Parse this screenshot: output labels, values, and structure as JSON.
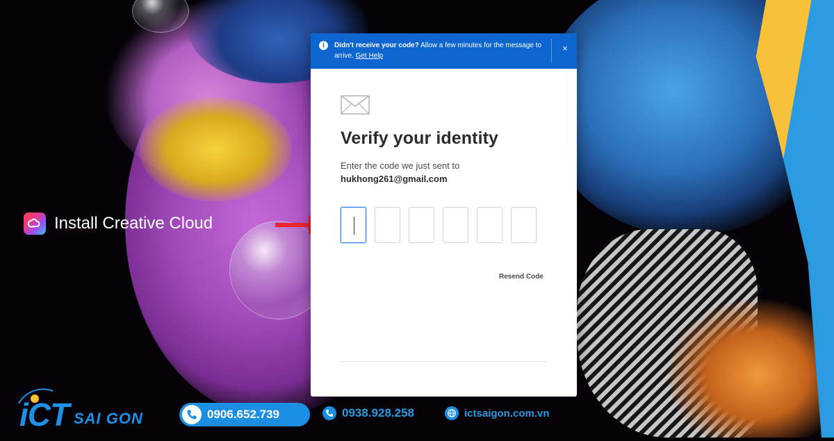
{
  "brand": {
    "install_label": "Install Creative Cloud",
    "ict_brand": "iCT",
    "ict_sub": "SAI GON"
  },
  "banner": {
    "strong_text": "Didn't receive your code?",
    "text": " Allow a few minutes for the message to arrive.",
    "link": "Get Help",
    "close": "×"
  },
  "dialog": {
    "title": "Verify your identity",
    "subtitle": "Enter the code we just sent to",
    "email": "hukhong261@gmail.com",
    "code_digits": [
      "",
      "",
      "",
      "",
      "",
      ""
    ],
    "resend": "Resend Code"
  },
  "contact": {
    "phone1": "0906.652.739",
    "phone2": "0938.928.258",
    "website": "ictsaigon.com.vn"
  },
  "colors": {
    "accent": "#0d66d0",
    "brand_blue": "#1a8fe3",
    "arrow": "#e8242c"
  }
}
